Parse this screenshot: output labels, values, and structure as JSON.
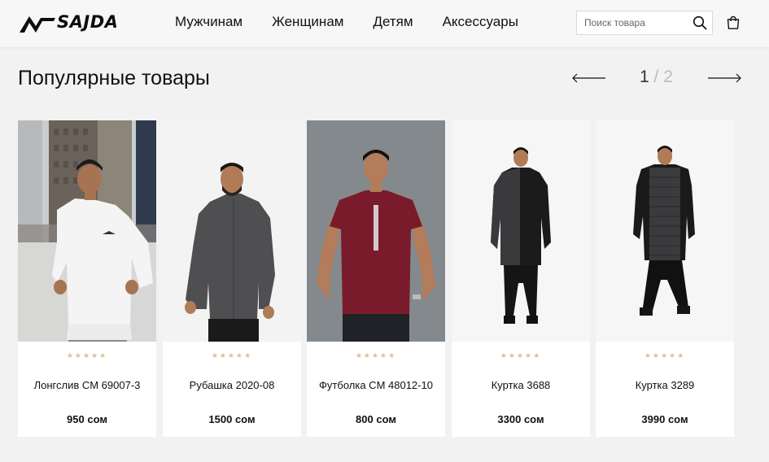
{
  "header": {
    "logo_text": "SAJDA",
    "nav": [
      "Мужчинам",
      "Женщинам",
      "Детям",
      "Аксессуары"
    ],
    "search_placeholder": "Поиск товара"
  },
  "section": {
    "title": "Популярные товары",
    "current_page": "1",
    "separator": "/",
    "total_pages": "2"
  },
  "products": [
    {
      "name": "Лонгслив CM 69007-3",
      "price": "950 сом",
      "stars": "★★★★★"
    },
    {
      "name": "Рубашка 2020-08",
      "price": "1500 сом",
      "stars": "★★★★★"
    },
    {
      "name": "Футболка CM 48012-10",
      "price": "800 сом",
      "stars": "★★★★★"
    },
    {
      "name": "Куртка 3688",
      "price": "3300 сом",
      "stars": "★★★★★"
    },
    {
      "name": "Куртка 3289",
      "price": "3990 сом",
      "stars": "★★★★★"
    }
  ],
  "colors": {
    "star": "#e0c08a",
    "shirt_red": "#7a1b2b",
    "background": "#f2f2f2"
  }
}
